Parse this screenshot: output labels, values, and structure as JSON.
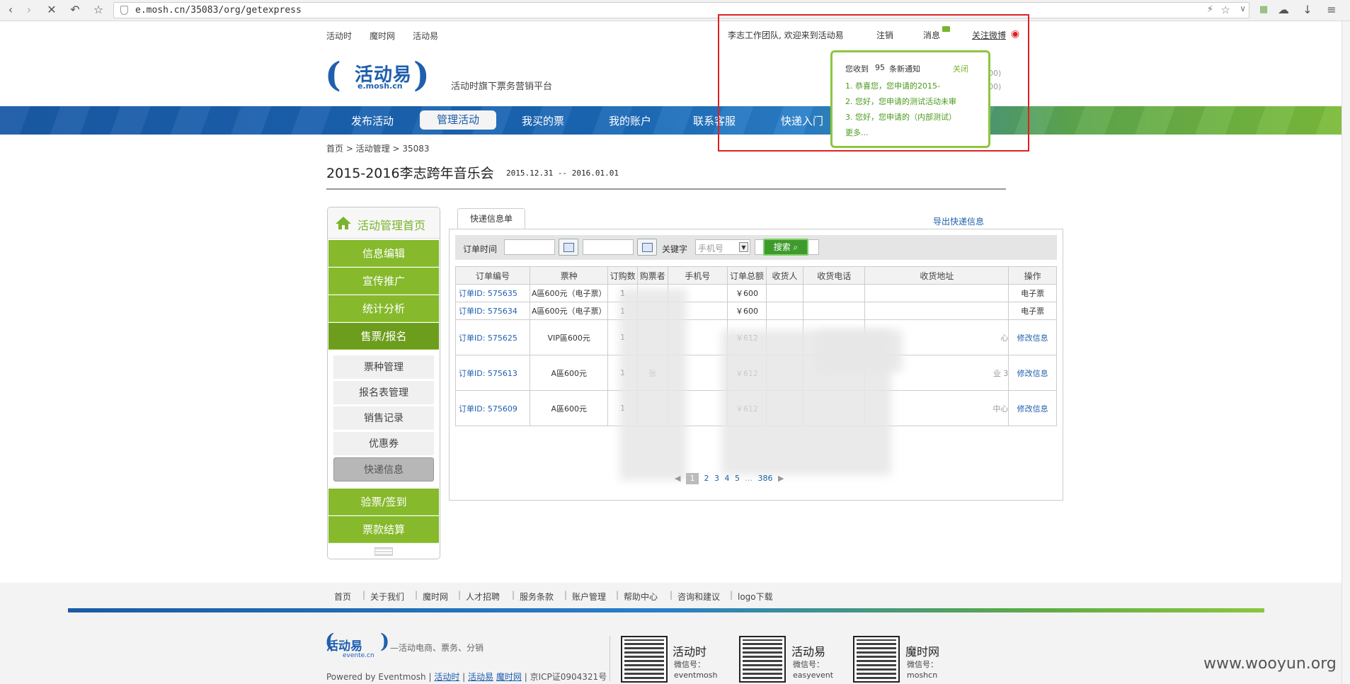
{
  "browser": {
    "url": "e.mosh.cn/35083/org/getexpress"
  },
  "top_links": [
    "活动时",
    "魔时网",
    "活动易"
  ],
  "top_right": {
    "welcome": "李志工作团队, 欢迎来到活动易",
    "logout": "注销",
    "messages": "消息",
    "weibo": "关注微博"
  },
  "logo": {
    "name": "活动易",
    "url": "e.mosh.cn"
  },
  "slogan": "活动时旗下票务营销平台",
  "nav": [
    "发布活动",
    "管理活动",
    "我买的票",
    "我的账户",
    "联系客服",
    "快递入门"
  ],
  "notification": {
    "prefix": "您收到",
    "count": "95",
    "suffix": "条新通知",
    "close": "关闭",
    "items": [
      "1.  恭喜您，您申请的2015-",
      "2.  您好，您申请的测试活动未审",
      "3.  您好，您申请的（内部测试）"
    ],
    "more": "更多...",
    "behind_text_1": "00)",
    "behind_text_2": "00)"
  },
  "breadcrumb": "首页 > 活动管理 > 35083",
  "event": {
    "title": "2015-2016李志跨年音乐会",
    "date": "2015.12.31 -- 2016.01.01"
  },
  "sidebar": {
    "home": "活动管理首页",
    "items": [
      "信息编辑",
      "宣传推广",
      "统计分析",
      "售票/报名"
    ],
    "sub_items": [
      "票种管理",
      "报名表管理",
      "销售记录",
      "优惠券",
      "快递信息"
    ],
    "items_bottom": [
      "验票/签到",
      "票款结算"
    ]
  },
  "panel": {
    "tab": "快递信息单",
    "export": "导出快递信息",
    "filter": {
      "order_time_label": "订单时间",
      "keyword_label": "关键字",
      "keyword_select": "手机号",
      "search": "搜索"
    },
    "columns": [
      "订单编号",
      "票种",
      "订购数",
      "购票者",
      "手机号",
      "订单总额",
      "收货人",
      "收货电话",
      "收货地址",
      "操作"
    ],
    "rows": [
      {
        "id": "订单ID: 575635",
        "ticket": "A區600元（电子票）",
        "qty": "1",
        "buyer": "",
        "phone": "",
        "total": "￥600",
        "receiver": "",
        "rphone": "",
        "address": "",
        "op": "电子票",
        "op_link": false
      },
      {
        "id": "订单ID: 575634",
        "ticket": "A區600元（电子票）",
        "qty": "1",
        "buyer": "",
        "phone": "",
        "total": "￥600",
        "receiver": "",
        "rphone": "",
        "address": "",
        "op": "电子票",
        "op_link": false
      },
      {
        "id": "订单ID: 575625",
        "ticket": "VIP區600元",
        "qty": "1",
        "buyer": "",
        "phone": "",
        "total": "￥612",
        "receiver": "",
        "rphone": "",
        "address": "心",
        "op": "修改信息",
        "op_link": true
      },
      {
        "id": "订单ID: 575613",
        "ticket": "A區600元",
        "qty": "1",
        "buyer": "张",
        "phone": "",
        "total": "￥612",
        "receiver": "",
        "rphone": "",
        "address": "业 3",
        "op": "修改信息",
        "op_link": true
      },
      {
        "id": "订单ID: 575609",
        "ticket": "A區600元",
        "qty": "1",
        "buyer": "",
        "phone": "",
        "total": "￥612",
        "receiver": "",
        "rphone": "",
        "address": "中心",
        "op": "修改信息",
        "op_link": true
      }
    ],
    "pager": {
      "prev": "◀",
      "current": "1",
      "pages": [
        "2",
        "3",
        "4",
        "5"
      ],
      "ellipsis": "...",
      "last": "386",
      "next": "▶"
    }
  },
  "footer": {
    "links": [
      "首页",
      "关于我们",
      "魔时网",
      "人才招聘",
      "服务条款",
      "账户管理",
      "帮助中心",
      "咨询和建议",
      "logo下载"
    ],
    "logo": "活动易",
    "logo_url": "evente.cn",
    "slogan": "—活动电商、票务、分销",
    "powered": "Powered by Eventmosh |",
    "powered_links": [
      "活动时",
      "活动易",
      "魔时网"
    ],
    "icp": "| 京ICP证0904321号",
    "qrs": [
      {
        "name": "活动时",
        "label": "微信号：",
        "account": "eventmosh"
      },
      {
        "name": "活动易",
        "label": "微信号：",
        "account": "easyevent"
      },
      {
        "name": "魔时网",
        "label": "微信号：",
        "account": "moshcn"
      }
    ]
  },
  "watermark": "www.wooyun.org"
}
